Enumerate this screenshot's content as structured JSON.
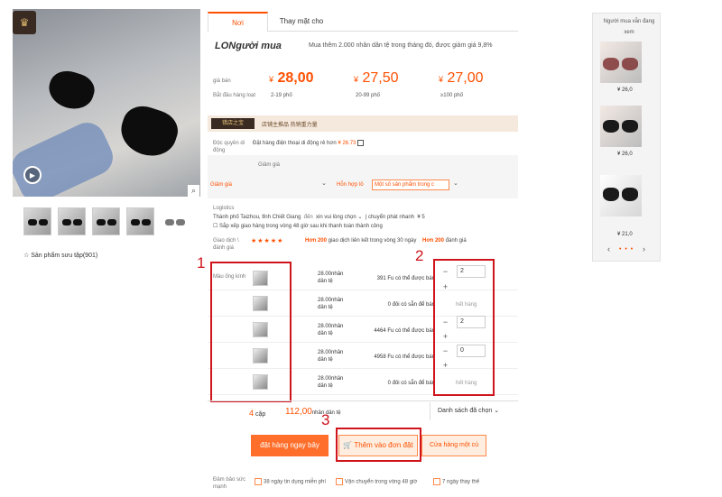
{
  "tabs": [
    "Nơi",
    "Thay mặt cho"
  ],
  "promo": {
    "logo": "LONgười mua",
    "text": "Mua thêm 2.000 nhân dân tệ trong tháng đó, được giảm giá 9,8%"
  },
  "pricing": {
    "label_price": "giá bán",
    "label_start": "Bắt đầu hàng loạt",
    "currency": "¥",
    "tiers": [
      {
        "price": "28,00",
        "range": "2-19 phố"
      },
      {
        "price": "27,50",
        "range": "20-99 phố"
      },
      {
        "price": "27,00",
        "range": "≥100 phố"
      }
    ]
  },
  "store_bar": {
    "badge": "错店之宝",
    "text": "店铺主推品  热销重力量"
  },
  "exclusive": {
    "label": "Độc quyền di động",
    "text": "Đặt hàng điện thoại di động rẻ hơn",
    "price": "¥ 26.73",
    "icon": "qr-icon"
  },
  "discount": {
    "heading": "Giảm giá",
    "label": "Giảm giá",
    "select_value": "",
    "mix_label": "Hỗn hợp lô",
    "mix_value": "Một số sản phẩm trong c"
  },
  "logistics": {
    "label": "Logistics",
    "origin": "Thành phố Taizhou, tỉnh Chiết Giang",
    "to": "đến",
    "dest": "xin vui lòng chọn",
    "express": "chuyển phát nhanh",
    "fee": "¥ 5",
    "note": "Sắp xếp giao hàng trong vòng 48 giờ sau khi thanh toán thành công"
  },
  "ratings": {
    "label": "Giao dịch \\ đánh giá",
    "stars": "★★★★★",
    "count1": "Hơn 200",
    "text1": "giao dịch liên kết trong vòng 30 ngày",
    "count2": "Hơn 200",
    "text2": "đánh giá"
  },
  "variants": {
    "label": "Màu ống kính",
    "rows": [
      {
        "price": "28.00nhân dân tệ",
        "stock": "391  Fu có thể được bán",
        "qty": "2",
        "out": ""
      },
      {
        "price": "28.00nhân dân tệ",
        "stock": "0  đôi có sẵn để bán",
        "qty": "",
        "out": "hết hàng"
      },
      {
        "price": "28.00nhân dân tệ",
        "stock": "4464  Fu có thể được bán",
        "qty": "2",
        "out": ""
      },
      {
        "price": "28.00nhân dân tệ",
        "stock": "4958  Fu có thể được bán",
        "qty": "0",
        "out": ""
      },
      {
        "price": "28.00nhân dân tệ",
        "stock": "0  đôi có sẵn để bán",
        "qty": "",
        "out": "hết hàng"
      }
    ]
  },
  "summary": {
    "count": "4",
    "count_unit": "cặp",
    "total": "112,00",
    "total_unit": "nhân dân tệ",
    "list_label": "Danh sách đã chọn"
  },
  "buttons": {
    "buy": "đặt hàng ngay bây",
    "add": "Thêm vào đơn đặt",
    "store": "Cửa hàng một cú"
  },
  "guarantee": {
    "label": "Đảm bảo sức mạnh",
    "items": [
      "38 ngày tin dụng miễn phí",
      "Vận chuyển trong vòng 48 giờ",
      "7 ngày thay thế"
    ]
  },
  "callouts": [
    "1",
    "2",
    "3"
  ],
  "gallery": {
    "favorites": "Sản phẩm sưu tập(901)"
  },
  "sidebar": {
    "title": "Người mua vẫn đang xem",
    "prices": [
      "¥ 26,0",
      "¥ 26,0",
      "¥ 21,0"
    ],
    "nav_prev": "‹",
    "nav_next": "›",
    "dots": "• • •"
  },
  "colors": {
    "accent": "#ff5000",
    "annotation": "#d0141c"
  }
}
